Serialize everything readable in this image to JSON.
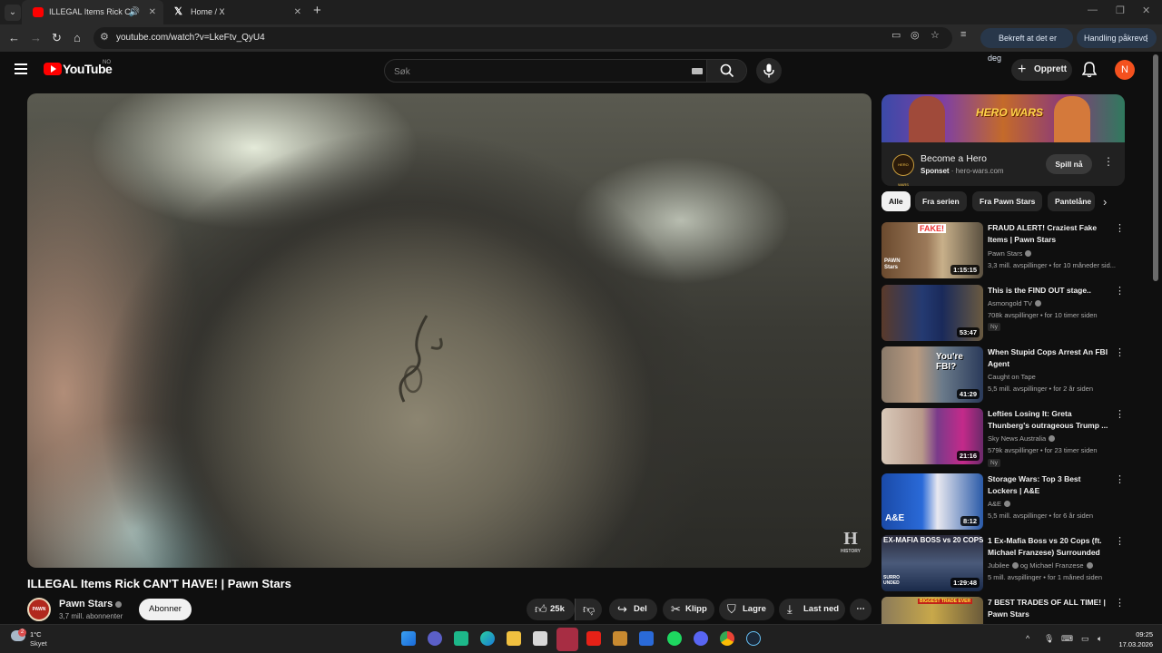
{
  "browser": {
    "tabs": [
      {
        "title": "ILLEGAL Items Rick CAN'T H",
        "active": true
      },
      {
        "title": "Home / X",
        "active": false
      }
    ],
    "url": "youtube.com/watch?v=LkeFtv_QyU4",
    "pill_verify": "Bekreft at det er deg",
    "pill_action": "Handling påkrevd"
  },
  "yt": {
    "logo": "YouTube",
    "country": "NO",
    "search_placeholder": "Søk",
    "create_label": "Opprett",
    "avatar_letter": "N"
  },
  "video": {
    "title": "ILLEGAL Items Rick CAN'T HAVE! | Pawn Stars",
    "watermark": "H",
    "watermark_sub": "HISTORY",
    "channel": {
      "name": "Pawn Stars",
      "subscribers": "3,7 mill. abonnenter",
      "avatar_text": "PAWN",
      "subscribe_label": "Abonner"
    },
    "actions": {
      "likes": "25k",
      "share": "Del",
      "clip": "Klipp",
      "save": "Lagre",
      "download": "Last ned"
    }
  },
  "ad": {
    "brand": "HERO WARS",
    "logo_text": "HERO WARS",
    "title": "Become a Hero",
    "sponsored": "Sponset",
    "domain": "hero-wars.com",
    "cta": "Spill nå"
  },
  "chips": [
    "Alle",
    "Fra serien",
    "Fra Pawn Stars",
    "Pantelåne"
  ],
  "recommendations": [
    {
      "title": "FRAUD ALERT! Craziest Fake Items | Pawn Stars",
      "channel": "Pawn Stars",
      "verified": true,
      "meta": "3,3 mill. avspillinger • for 10 måneder sid...",
      "duration": "1:15:15",
      "badge": ""
    },
    {
      "title": "This is the FIND OUT stage..",
      "channel": "Asmongold TV",
      "verified": true,
      "meta": "708k avspillinger • for 10 timer siden",
      "duration": "53:47",
      "badge": "Ny"
    },
    {
      "title": "When Stupid Cops Arrest An FBI Agent",
      "channel": "Caught on Tape",
      "verified": false,
      "meta": "5,5 mill. avspillinger • for 2 år siden",
      "duration": "41:29",
      "badge": ""
    },
    {
      "title": "Lefties Losing It: Greta Thunberg's outrageous Trump ...",
      "channel": "Sky News Australia",
      "verified": true,
      "meta": "579k avspillinger • for 23 timer siden",
      "duration": "21:16",
      "badge": "Ny"
    },
    {
      "title": "Storage Wars: Top 3 Best Lockers | A&E",
      "channel": "A&E",
      "verified": true,
      "meta": "5,5 mill. avspillinger • for 6 år siden",
      "duration": "8:12",
      "badge": ""
    },
    {
      "title": "1 Ex-Mafia Boss vs 20 Cops (ft. Michael Franzese) Surrounded",
      "channel": "Jubilee",
      "channel2": "og Michael Franzese",
      "verified": true,
      "meta": "5 mill. avspillinger • for 1 måned siden",
      "duration": "1:29:48",
      "badge": ""
    },
    {
      "title": "7 BEST TRADES OF ALL TIME! | Pawn Stars",
      "channel": "",
      "verified": false,
      "meta": "",
      "duration": "",
      "badge": ""
    }
  ],
  "thumb_text": {
    "fake": "FAKE!",
    "pawn_stars": "PAWN Stars",
    "youre_fbi": "You're FBI?",
    "ae": "A&E",
    "ex_mafia": "EX-MAFIA BOSS vs 20 COPS",
    "surrounded": "SURRO UNDED",
    "biggest_trade": "BIGGEST TRADE EVER"
  },
  "taskbar": {
    "weather_temp": "1°C",
    "weather_desc": "Skyet",
    "weather_badge": "2",
    "time": "09:25",
    "date": "17.03.2026"
  }
}
